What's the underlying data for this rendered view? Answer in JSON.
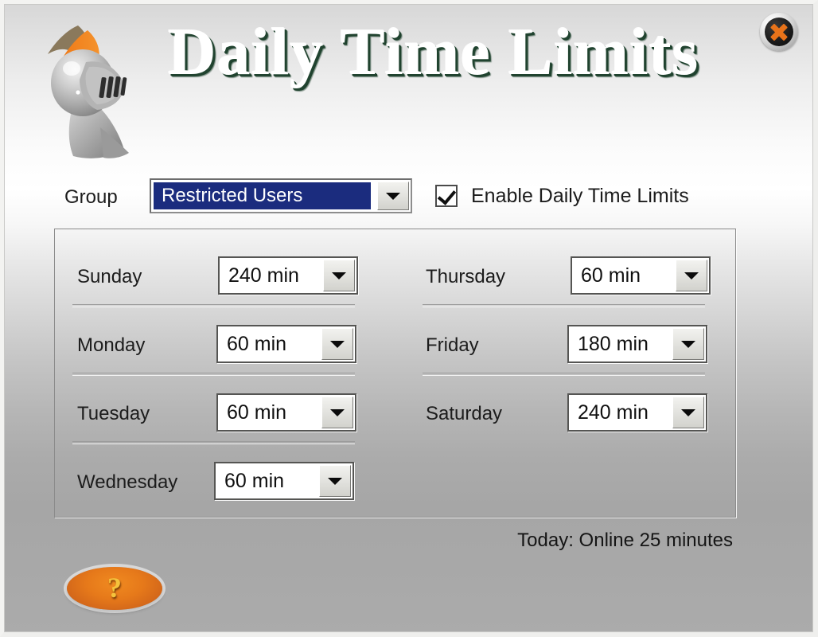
{
  "window": {
    "title": "Daily Time Limits",
    "logo_icon": "knight-helmet-icon",
    "close_icon": "close-x-icon",
    "accent_orange": "#e8731a",
    "title_shadow_green": "#20432f",
    "selection_blue": "#1b2c7e"
  },
  "group": {
    "label": "Group",
    "selected": "Restricted Users",
    "dropdown_icon": "chevron-down-icon"
  },
  "enable": {
    "label": "Enable Daily Time Limits",
    "checked": true,
    "check_icon": "checkmark-icon"
  },
  "days": {
    "left_column": [
      {
        "name": "Sunday",
        "limit": "240 min",
        "separator": true
      },
      {
        "name": "Monday",
        "limit": "60 min",
        "separator": true
      },
      {
        "name": "Tuesday",
        "limit": "60 min",
        "separator": true
      },
      {
        "name": "Wednesday",
        "limit": "60 min",
        "separator": false
      }
    ],
    "right_column": [
      {
        "name": "Thursday",
        "limit": "60 min",
        "separator": true
      },
      {
        "name": "Friday",
        "limit": "180 min",
        "separator": true
      },
      {
        "name": "Saturday",
        "limit": "240 min",
        "separator": false
      }
    ]
  },
  "footer": {
    "today_status": "Today: Online 25 minutes",
    "help_label": "?",
    "help_icon": "question-mark-icon"
  }
}
